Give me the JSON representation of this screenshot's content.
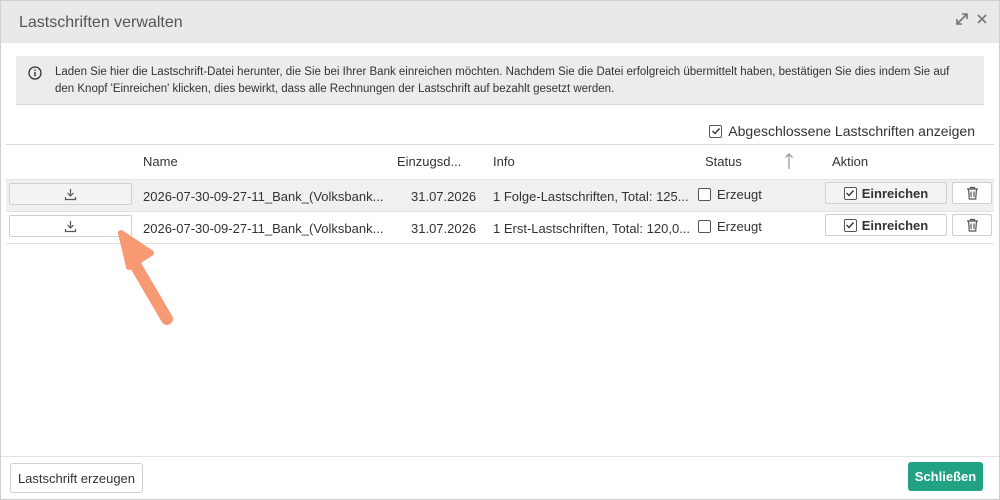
{
  "dialog": {
    "title": "Lastschriften verwalten",
    "icons": [
      "expand-icon",
      "close-icon"
    ]
  },
  "info": {
    "icon": "info-circle-icon",
    "text": "Laden Sie hier die Lastschrift-Datei herunter, die Sie bei Ihrer Bank einreichen möchten. Nachdem Sie die Datei erfolgreich übermittelt haben, bestätigen Sie dies indem Sie auf den Knopf 'Einreichen' klicken, dies bewirkt, dass alle Rechnungen der Lastschrift auf bezahlt gesetzt werden."
  },
  "filter": {
    "show_closed_label": "Abgeschlossene Lastschriften anzeigen",
    "show_closed_checked": true
  },
  "table": {
    "columns": [
      "Name",
      "Einzugsd...",
      "Info",
      "Status",
      "Aktion"
    ],
    "rows": [
      {
        "name": "2026-07-30-09-27-11_Bank_(Volksbank...",
        "date": "31.07.2026",
        "info": "1 Folge-Lastschriften, Total: 125...",
        "status": "Erzeugt",
        "action": "Einreichen"
      },
      {
        "name": "2026-07-30-09-27-11_Bank_(Volksbank...",
        "date": "31.07.2026",
        "info": "1 Erst-Lastschriften, Total: 120,0...",
        "status": "Erzeugt",
        "action": "Einreichen"
      }
    ]
  },
  "footer": {
    "create_label": "Lastschrift erzeugen",
    "close_label": "Schließen"
  },
  "colors": {
    "primary": "#21a383",
    "annotation_arrow": "#f79a74"
  }
}
